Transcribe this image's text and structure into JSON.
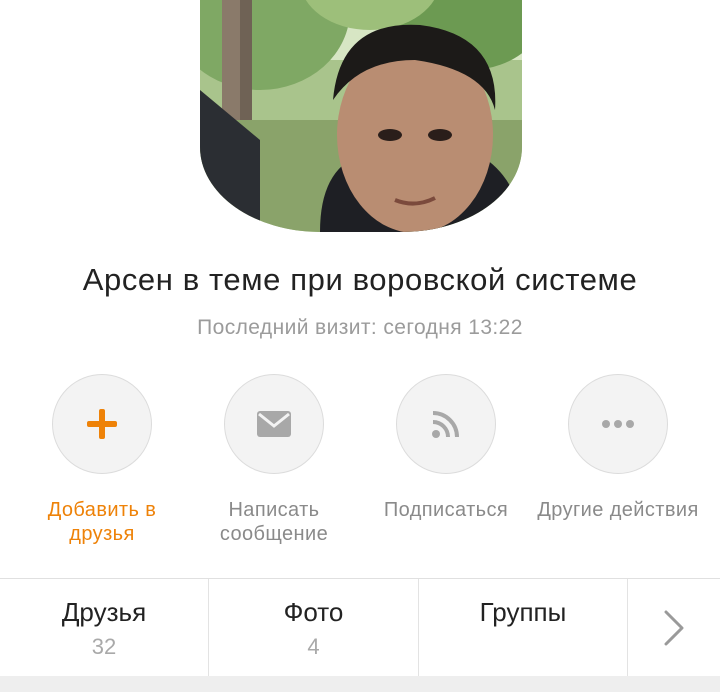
{
  "profile": {
    "name": "Арсен в теме при воровской системе",
    "last_visit": "Последний визит: сегодня 13:22"
  },
  "actions": [
    {
      "label": "Добавить в друзья",
      "icon": "plus-icon",
      "color": "#ee8208"
    },
    {
      "label": "Написать сообщение",
      "icon": "envelope-icon"
    },
    {
      "label": "Подписаться",
      "icon": "rss-icon"
    },
    {
      "label": "Другие действия",
      "icon": "more-dots-icon"
    }
  ],
  "tabs": [
    {
      "title": "Друзья",
      "count": "32"
    },
    {
      "title": "Фото",
      "count": "4"
    },
    {
      "title": "Группы",
      "count": ""
    }
  ],
  "colors": {
    "accent": "#ee8208",
    "muted": "#9b9b9b",
    "icon_gray": "#a8a8a8"
  }
}
